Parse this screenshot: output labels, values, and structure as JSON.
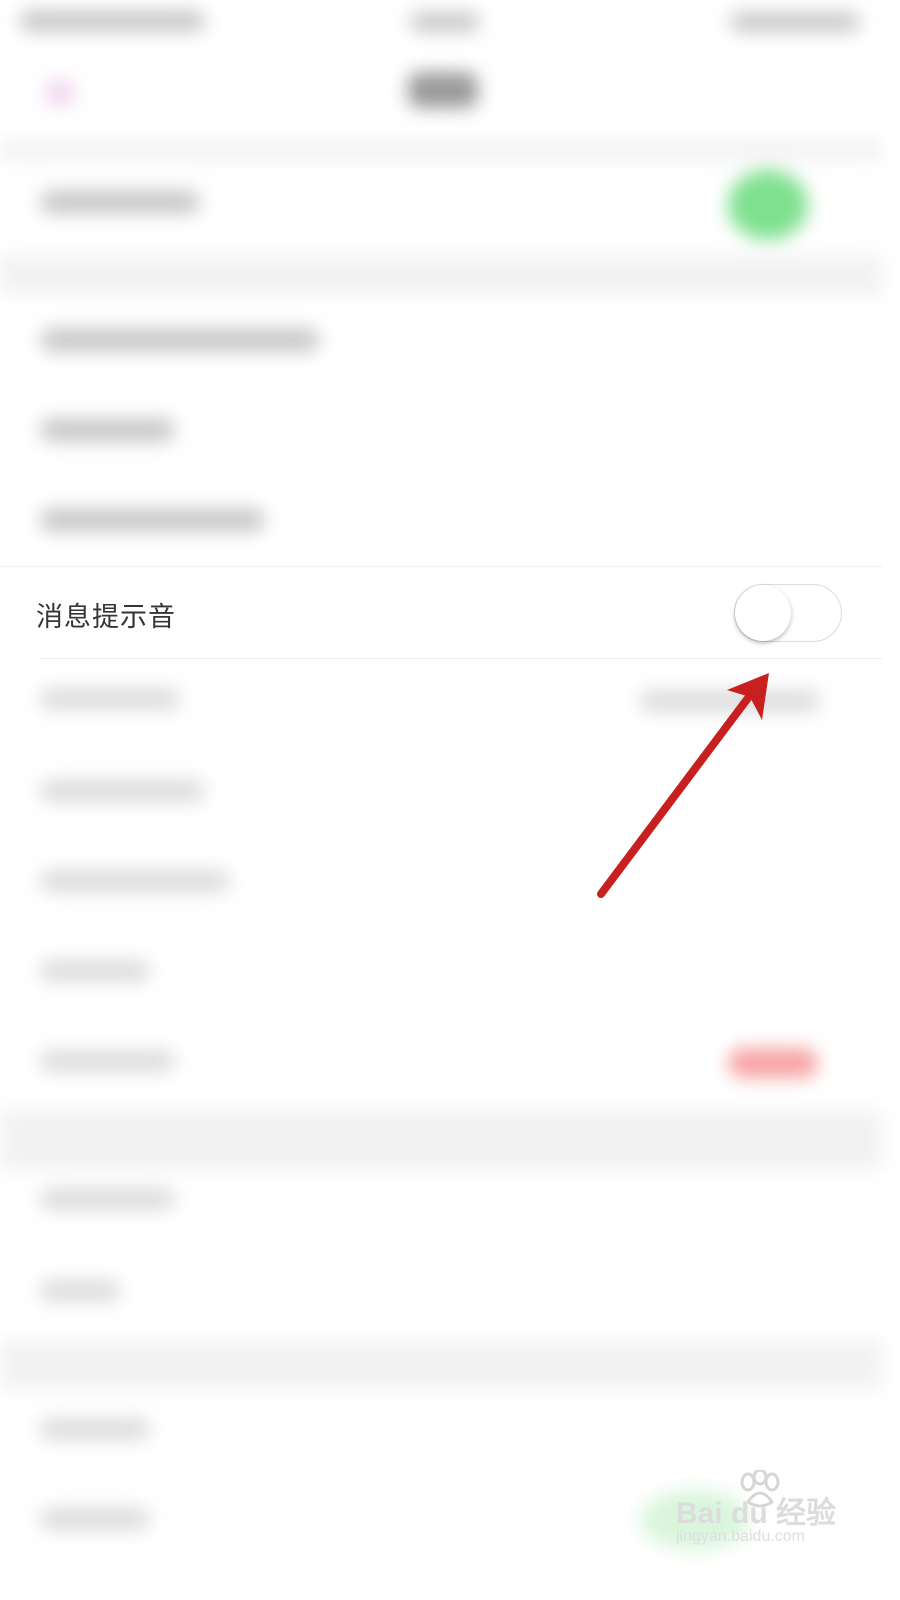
{
  "setting_row": {
    "label": "消息提示音",
    "toggle_state": "off"
  },
  "annotation": {
    "arrow_color": "#c8201f"
  },
  "watermark": {
    "brand": "Bai du 经验",
    "url": "jingyan.baidu.com"
  }
}
